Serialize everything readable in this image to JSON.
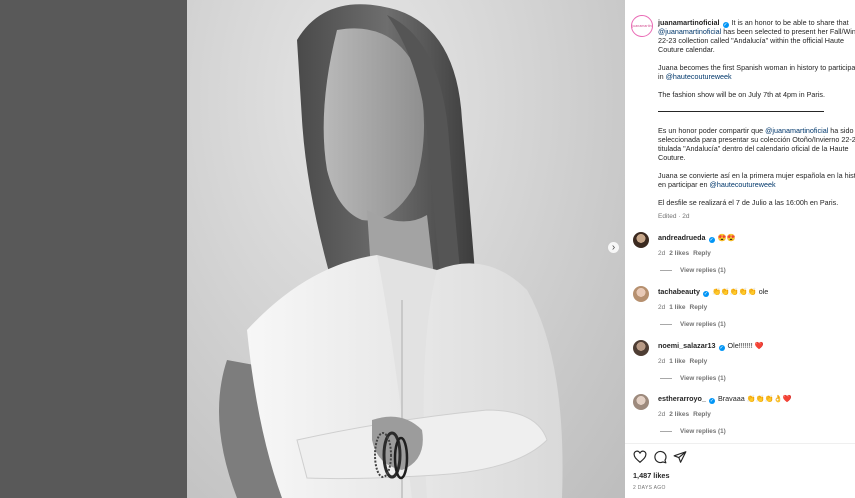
{
  "post": {
    "owner_avatar_text": "juanamartin",
    "caption_en": {
      "l1": "It is an honor to be able to share that",
      "mention1": "@juanamartinoficial",
      "l2": " has been selected to present her Fall/Win",
      "l3": "22-23 collection called \"Andalucía\" within the official Haute",
      "l4": "Couture calendar.",
      "l5": "Juana becomes the first Spanish woman in history to participa",
      "l6a": "in ",
      "mention2": "@hautecoutureweek",
      "l7": "The fashion show will be on July 7th at 4pm in Paris."
    },
    "caption_es": {
      "l1": "Es un honor poder compartir que ",
      "mention1": "@juanamartinoficial",
      "l1b": " ha sido",
      "l2": "seleccionada para presentar su colección Otoño/Invierno 22-2",
      "l3": "titulada \"Andalucía\" dentro del calendario oficial de la Haute",
      "l4": "Couture.",
      "l5": "Juana se convierte así en la primera mujer española en la histo",
      "l6a": "en participar en ",
      "mention2": "@hautecoutureweek",
      "l7": "El desfile se realizará el 7 de Julio a las 16:00h en Paris."
    },
    "edited": "Edited · 2d",
    "likes": "1,487 likes",
    "time_ago": "2 DAYS AGO"
  },
  "owner": {
    "username": "juanamartinoficial"
  },
  "comments": [
    {
      "username": "andreadrueda",
      "text": "😍😍",
      "time": "2d",
      "likes": "2 likes",
      "reply": "Reply",
      "view_replies": "View replies (1)"
    },
    {
      "username": "tachabeauty",
      "text": "👏👏👏👏👏 ole",
      "time": "2d",
      "likes": "1 like",
      "reply": "Reply",
      "view_replies": "View replies (1)"
    },
    {
      "username": "noemi_salazar13",
      "text": "Ole!!!!!!! ❤️",
      "time": "2d",
      "likes": "1 like",
      "reply": "Reply",
      "view_replies": "View replies (1)"
    },
    {
      "username": "estherarroyo_",
      "text": "Bravaaa 👏👏👏👌❤️",
      "time": "2d",
      "likes": "2 likes",
      "reply": "Reply",
      "view_replies": "View replies (1)"
    }
  ],
  "icons": {
    "verified": "verified-badge-icon",
    "like": "heart-icon",
    "comment": "comment-icon",
    "share": "share-icon",
    "next": "chevron-right-icon"
  },
  "colors": {
    "mention": "#00376b",
    "verified": "#0095f6",
    "muted": "#737373"
  }
}
